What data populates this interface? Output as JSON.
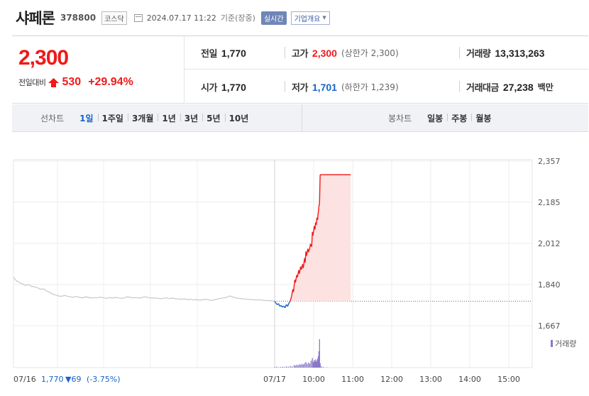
{
  "header": {
    "stock_name": "샤페론",
    "stock_code": "378800",
    "market": "코스닥",
    "datetime": "2024.07.17 11:22",
    "basis": "기준(장중)",
    "realtime_label": "실시간",
    "company_info_label": "기업개요"
  },
  "quote": {
    "current_price": "2,300",
    "change_label": "전일대비",
    "change_amount": "530",
    "change_percent": "+29.94%",
    "prev_close_label": "전일",
    "prev_close": "1,770",
    "open_label": "시가",
    "open": "1,770",
    "high_label": "고가",
    "high": "2,300",
    "upper_limit": "(상한가 2,300)",
    "low_label": "저가",
    "low": "1,701",
    "lower_limit": "(하한가 1,239)",
    "volume_label": "거래량",
    "volume": "13,313,263",
    "value_label": "거래대금",
    "value": "27,238",
    "value_unit": "백만"
  },
  "line_tabs": {
    "label": "선차트",
    "items": [
      "1일",
      "1주일",
      "3개월",
      "1년",
      "3년",
      "5년",
      "10년"
    ],
    "active": 0
  },
  "candle_tabs": {
    "label": "봉차트",
    "items": [
      "일봉",
      "주봉",
      "월봉"
    ]
  },
  "colors": {
    "up": "#f01a1a",
    "down": "#1863c8",
    "prev_day_line": "#c7c7c7",
    "fill": "#fde2e2",
    "volume": "#8a78c8"
  },
  "chart_data": {
    "type": "line",
    "y_ticks": [
      "2,357",
      "2,185",
      "2,012",
      "1,840",
      "1,667"
    ],
    "y_tick_values": [
      2357,
      2185,
      2012,
      1840,
      1667
    ],
    "ylim": [
      1667,
      2357
    ],
    "reference_price": 1770,
    "x_ticks": [
      "07/17",
      "10:00",
      "11:00",
      "12:00",
      "13:00",
      "14:00",
      "15:00"
    ],
    "x_tick_minutes": [
      0,
      60,
      120,
      180,
      240,
      300,
      360
    ],
    "volume_label": "거래량",
    "prev_day_label": "07/16",
    "prev_day_close": "1,770",
    "prev_day_change": "▼69",
    "prev_day_pct": "(-3.75%)",
    "prev_day_series": [
      1870,
      1855,
      1848,
      1842,
      1836,
      1840,
      1832,
      1830,
      1826,
      1820,
      1822,
      1812,
      1808,
      1800,
      1796,
      1792,
      1790,
      1794,
      1790,
      1788,
      1786,
      1790,
      1786,
      1784,
      1788,
      1786,
      1783,
      1785,
      1784,
      1787,
      1784,
      1782,
      1785,
      1783,
      1786,
      1784,
      1782,
      1784,
      1788,
      1786,
      1784,
      1785,
      1783,
      1786,
      1788,
      1785,
      1783,
      1784,
      1782,
      1780,
      1782,
      1784,
      1781,
      1783,
      1780,
      1779,
      1778,
      1780,
      1776,
      1778,
      1775,
      1777,
      1774,
      1776,
      1778,
      1775,
      1773,
      1776,
      1779,
      1782,
      1784,
      1786,
      1792,
      1788,
      1784,
      1782,
      1780,
      1779,
      1778,
      1777,
      1776,
      1775,
      1776,
      1774,
      1772,
      1773,
      1771,
      1770
    ],
    "today_series": [
      {
        "t": 0,
        "v": 1770
      },
      {
        "t": 2,
        "v": 1762
      },
      {
        "t": 4,
        "v": 1755
      },
      {
        "t": 6,
        "v": 1760
      },
      {
        "t": 8,
        "v": 1748
      },
      {
        "t": 10,
        "v": 1752
      },
      {
        "t": 12,
        "v": 1745
      },
      {
        "t": 14,
        "v": 1750
      },
      {
        "t": 16,
        "v": 1742
      },
      {
        "t": 18,
        "v": 1756
      },
      {
        "t": 20,
        "v": 1748
      },
      {
        "t": 22,
        "v": 1762
      },
      {
        "t": 24,
        "v": 1770
      },
      {
        "t": 26,
        "v": 1790
      },
      {
        "t": 28,
        "v": 1820
      },
      {
        "t": 29,
        "v": 1808
      },
      {
        "t": 31,
        "v": 1860
      },
      {
        "t": 32,
        "v": 1848
      },
      {
        "t": 34,
        "v": 1880
      },
      {
        "t": 35,
        "v": 1870
      },
      {
        "t": 37,
        "v": 1900
      },
      {
        "t": 38,
        "v": 1885
      },
      {
        "t": 40,
        "v": 1915
      },
      {
        "t": 41,
        "v": 1902
      },
      {
        "t": 43,
        "v": 1925
      },
      {
        "t": 44,
        "v": 1908
      },
      {
        "t": 46,
        "v": 1950
      },
      {
        "t": 47,
        "v": 1932
      },
      {
        "t": 48,
        "v": 1978
      },
      {
        "t": 49,
        "v": 1960
      },
      {
        "t": 51,
        "v": 1990
      },
      {
        "t": 52,
        "v": 1975
      },
      {
        "t": 54,
        "v": 1992
      },
      {
        "t": 55,
        "v": 2010
      },
      {
        "t": 57,
        "v": 1998
      },
      {
        "t": 58,
        "v": 2060
      },
      {
        "t": 59,
        "v": 2045
      },
      {
        "t": 61,
        "v": 2085
      },
      {
        "t": 62,
        "v": 2070
      },
      {
        "t": 63,
        "v": 2100
      },
      {
        "t": 64,
        "v": 2090
      },
      {
        "t": 65,
        "v": 2120
      },
      {
        "t": 66,
        "v": 2110
      },
      {
        "t": 67,
        "v": 2140
      },
      {
        "t": 68,
        "v": 2165
      },
      {
        "t": 69,
        "v": 2180
      },
      {
        "t": 70,
        "v": 2300
      },
      {
        "t": 75,
        "v": 2300
      },
      {
        "t": 90,
        "v": 2300
      },
      {
        "t": 105,
        "v": 2300
      },
      {
        "t": 117,
        "v": 2300
      }
    ],
    "volume_bars": [
      {
        "t": 0,
        "v": 2
      },
      {
        "t": 3,
        "v": 3
      },
      {
        "t": 6,
        "v": 1
      },
      {
        "t": 9,
        "v": 2
      },
      {
        "t": 12,
        "v": 3
      },
      {
        "t": 15,
        "v": 2
      },
      {
        "t": 18,
        "v": 4
      },
      {
        "t": 21,
        "v": 3
      },
      {
        "t": 24,
        "v": 5
      },
      {
        "t": 27,
        "v": 4
      },
      {
        "t": 30,
        "v": 8
      },
      {
        "t": 32,
        "v": 6
      },
      {
        "t": 34,
        "v": 9
      },
      {
        "t": 36,
        "v": 7
      },
      {
        "t": 38,
        "v": 11
      },
      {
        "t": 40,
        "v": 9
      },
      {
        "t": 42,
        "v": 12
      },
      {
        "t": 44,
        "v": 10
      },
      {
        "t": 46,
        "v": 14
      },
      {
        "t": 48,
        "v": 18
      },
      {
        "t": 50,
        "v": 12
      },
      {
        "t": 52,
        "v": 16
      },
      {
        "t": 54,
        "v": 13
      },
      {
        "t": 56,
        "v": 22
      },
      {
        "t": 58,
        "v": 30
      },
      {
        "t": 59,
        "v": 19
      },
      {
        "t": 60,
        "v": 16
      },
      {
        "t": 61,
        "v": 24
      },
      {
        "t": 62,
        "v": 20
      },
      {
        "t": 63,
        "v": 26
      },
      {
        "t": 64,
        "v": 18
      },
      {
        "t": 65,
        "v": 22
      },
      {
        "t": 66,
        "v": 28
      },
      {
        "t": 67,
        "v": 36
      },
      {
        "t": 68,
        "v": 52
      },
      {
        "t": 69,
        "v": 90
      },
      {
        "t": 70,
        "v": 14
      },
      {
        "t": 72,
        "v": 4
      },
      {
        "t": 75,
        "v": 2
      },
      {
        "t": 80,
        "v": 1
      }
    ]
  }
}
